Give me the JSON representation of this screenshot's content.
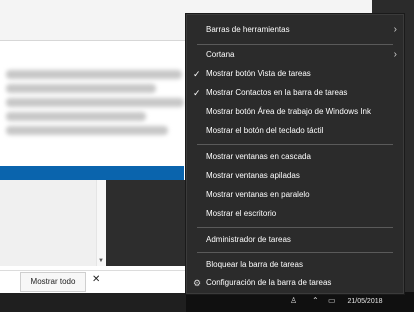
{
  "notification": {
    "show_all_label": "Mostrar todo",
    "close_label": "✕"
  },
  "taskbar": {
    "date": "21/05/2018"
  },
  "context_menu": {
    "items": [
      {
        "label": "Barras de herramientas",
        "has_submenu": true,
        "checked": false
      },
      {
        "label": "Cortana",
        "has_submenu": true,
        "checked": false
      },
      {
        "label": "Mostrar botón Vista de tareas",
        "has_submenu": false,
        "checked": true
      },
      {
        "label": "Mostrar Contactos en la barra de tareas",
        "has_submenu": false,
        "checked": true
      },
      {
        "label": "Mostrar botón Área de trabajo de Windows Ink",
        "has_submenu": false,
        "checked": false
      },
      {
        "label": "Mostrar el botón del teclado táctil",
        "has_submenu": false,
        "checked": false
      },
      {
        "label": "Mostrar ventanas en cascada",
        "has_submenu": false,
        "checked": false
      },
      {
        "label": "Mostrar ventanas apiladas",
        "has_submenu": false,
        "checked": false
      },
      {
        "label": "Mostrar ventanas en paralelo",
        "has_submenu": false,
        "checked": false
      },
      {
        "label": "Mostrar el escritorio",
        "has_submenu": false,
        "checked": false
      },
      {
        "label": "Administrador de tareas",
        "has_submenu": false,
        "checked": false
      },
      {
        "label": "Bloquear la barra de tareas",
        "has_submenu": false,
        "checked": false
      },
      {
        "label": "Configuración de la barra de tareas",
        "has_submenu": false,
        "checked": false,
        "icon": "gear-icon"
      }
    ]
  }
}
